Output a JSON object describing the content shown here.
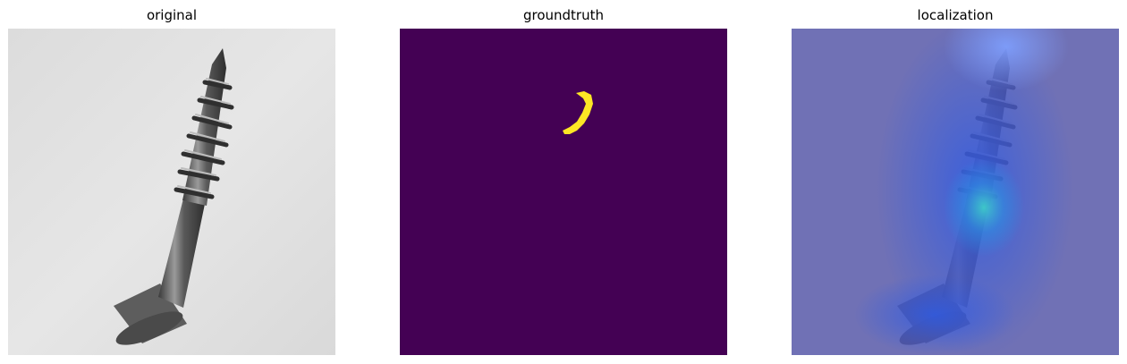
{
  "panels": [
    {
      "title": "original"
    },
    {
      "title": "groundtruth"
    },
    {
      "title": "localization"
    }
  ],
  "colors": {
    "mask_background": "#440154",
    "mask_defect": "#fde725",
    "overlay_tint": "#6f70b8",
    "heat_hot": "#3fd3c8"
  },
  "icons": [
    "screw-image",
    "defect-mask",
    "anomaly-heatmap"
  ]
}
